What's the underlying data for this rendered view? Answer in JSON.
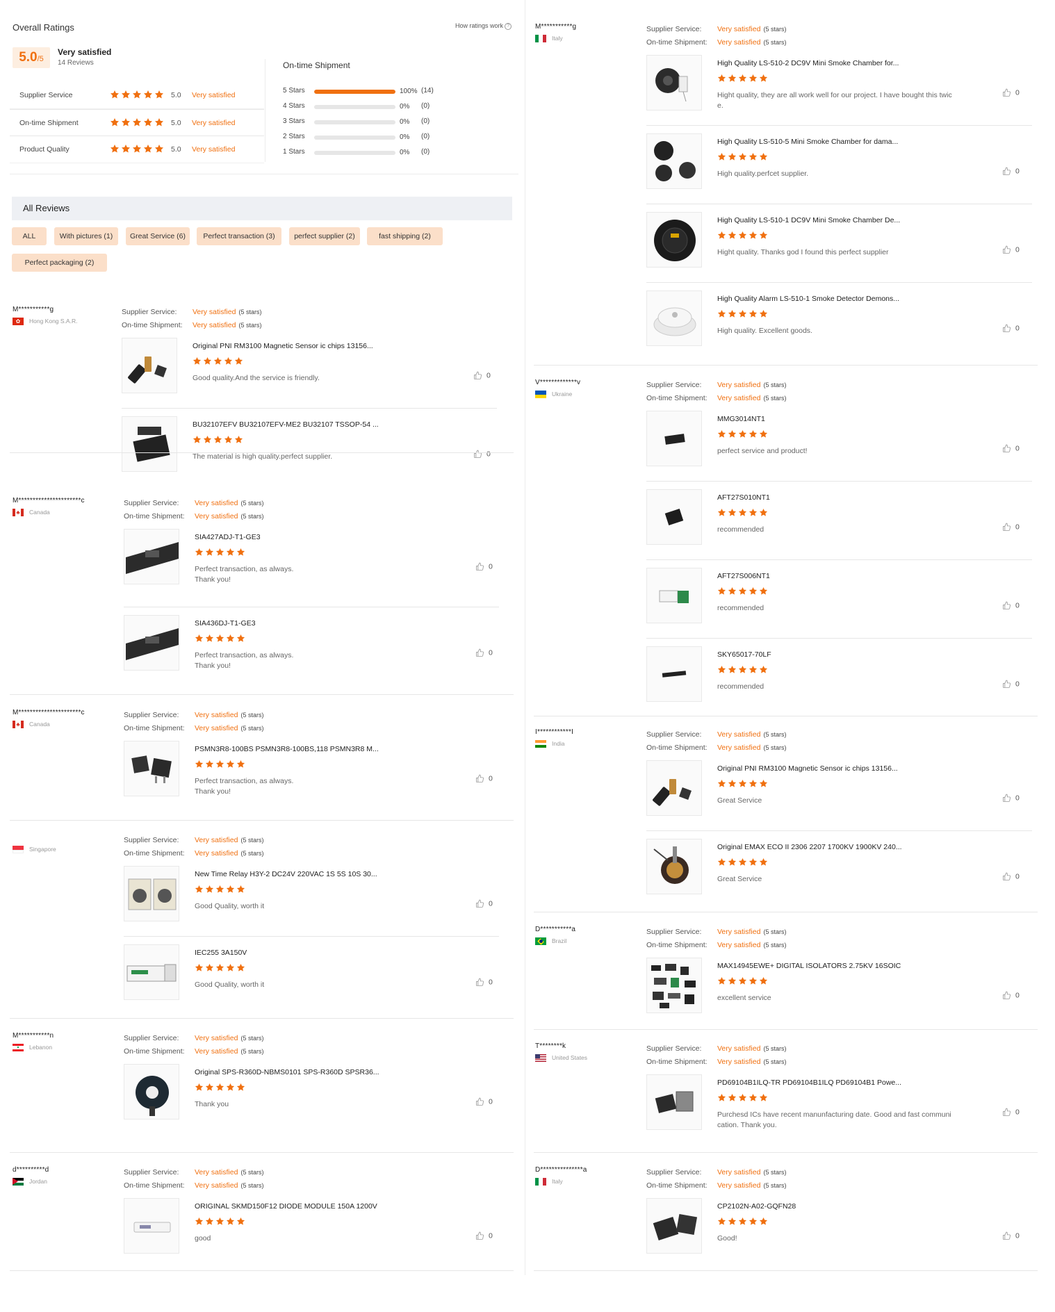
{
  "overall": {
    "header": "Overall Ratings",
    "how_link": "How ratings work",
    "score": "5.0",
    "score_max": "/5",
    "summary": "Very satisfied",
    "review_count": "14 Reviews",
    "rows": [
      {
        "label": "Supplier Service",
        "score": "5.0",
        "text": "Very satisfied",
        "stars": 5
      },
      {
        "label": "On-time Shipment",
        "score": "5.0",
        "text": "Very satisfied",
        "stars": 5
      },
      {
        "label": "Product Quality",
        "score": "5.0",
        "text": "Very satisfied",
        "stars": 5
      }
    ],
    "distribution_title": "On-time Shipment",
    "distribution": [
      {
        "label": "5 Stars",
        "percent": "100%",
        "count": "(14)",
        "fraction": 1.0
      },
      {
        "label": "4 Stars",
        "percent": "0%",
        "count": "(0)",
        "fraction": 0
      },
      {
        "label": "3 Stars",
        "percent": "0%",
        "count": "(0)",
        "fraction": 0
      },
      {
        "label": "2 Stars",
        "percent": "0%",
        "count": "(0)",
        "fraction": 0
      },
      {
        "label": "1 Stars",
        "percent": "0%",
        "count": "(0)",
        "fraction": 0
      }
    ]
  },
  "all_reviews": {
    "title": "All Reviews",
    "filters": [
      "ALL",
      "With pictures (1)",
      "Great Service (6)",
      "Perfect transaction (3)",
      "perfect supplier (2)",
      "fast shipping (2)",
      "Perfect packaging (2)"
    ]
  },
  "labels": {
    "supplier_service": "Supplier Service:",
    "ontime_shipment": "On-time Shipment:",
    "very_satisfied": "Very satisfied",
    "five_stars": "(5 stars)"
  },
  "reviews_left": [
    {
      "user": "M***********g",
      "country": "Hong Kong S.A.R.",
      "flag": "hk",
      "products": [
        {
          "title": "Original PNI RM3100 Magnetic Sensor ic chips 13156...",
          "comment": "Good quality.And the service is friendly.",
          "likes": "0",
          "img": "ic-small"
        },
        {
          "title": "BU32107EFV BU32107EFV-ME2 BU32107 TSSOP-54 ...",
          "comment": "The material is high quality.perfect supplier.",
          "likes": "0",
          "img": "ic-flat"
        }
      ]
    },
    {
      "user": "M**********************c",
      "country": "Canada",
      "flag": "ca",
      "products": [
        {
          "title": "SIA427ADJ-T1-GE3",
          "comment": "Perfect transaction, as always.\nThank you!",
          "likes": "0",
          "img": "tape"
        },
        {
          "title": "SIA436DJ-T1-GE3",
          "comment": "Perfect transaction, as always.\nThank you!",
          "likes": "0",
          "img": "tape"
        }
      ]
    },
    {
      "user": "M**********************c",
      "country": "Canada",
      "flag": "ca",
      "products": [
        {
          "title": "PSMN3R8-100BS PSMN3R8-100BS,118 PSMN3R8 M...",
          "comment": "Perfect transaction, as always.\nThank you!",
          "likes": "0",
          "img": "mosfet"
        }
      ]
    },
    {
      "user": "",
      "country": "Singapore",
      "flag": "sg",
      "products": [
        {
          "title": "New Time Relay H3Y-2 DC24V 220VAC 1S 5S 10S 30...",
          "comment": "Good Quality, worth it",
          "likes": "0",
          "img": "relay"
        },
        {
          "title": "IEC255 3A150V",
          "comment": "Good Quality, worth it",
          "likes": "0",
          "img": "box"
        }
      ]
    },
    {
      "user": "M***********n",
      "country": "Lebanon",
      "flag": "lb",
      "products": [
        {
          "title": "Original SPS-R360D-NBMS0101 SPS-R360D SPSR36...",
          "comment": "Thank you",
          "likes": "0",
          "img": "sensor"
        }
      ]
    },
    {
      "user": "d**********d",
      "country": "Jordan",
      "flag": "jo",
      "products": [
        {
          "title": "ORIGINAL SKMD150F12 DIODE MODULE 150A 1200V",
          "comment": "good",
          "likes": "0",
          "img": "module"
        }
      ]
    }
  ],
  "reviews_right": [
    {
      "user": "M***********g",
      "country": "Italy",
      "flag": "it",
      "products": [
        {
          "title": "High Quality LS-510-2 DC9V Mini Smoke Chamber for...",
          "comment": "Hight quality, they are all work well for our project. I have bought this twic\ne.",
          "likes": "0",
          "img": "chamber"
        },
        {
          "title": "High Quality LS-510-5 Mini Smoke Chamber for dama...",
          "comment": "High quality.perfcet supplier.",
          "likes": "0",
          "img": "chamber2"
        },
        {
          "title": "High Quality LS-510-1 DC9V Mini Smoke Chamber De...",
          "comment": "Hight quality. Thanks god I found this perfect supplier",
          "likes": "0",
          "img": "round"
        },
        {
          "title": "High Quality Alarm LS-510-1 Smoke Detector Demons...",
          "comment": "High quality. Excellent goods.",
          "likes": "0",
          "img": "detector"
        }
      ]
    },
    {
      "user": "V*************v",
      "country": "Ukraine",
      "flag": "ua",
      "products": [
        {
          "title": "MMG3014NT1",
          "comment": "perfect service and product!",
          "likes": "0",
          "img": "chip-sm"
        },
        {
          "title": "AFT27S010NT1",
          "comment": "recommended",
          "likes": "0",
          "img": "chip-sq"
        },
        {
          "title": "AFT27S006NT1",
          "comment": "recommended",
          "likes": "0",
          "img": "chip-green"
        },
        {
          "title": "SKY65017-70LF",
          "comment": "recommended",
          "likes": "0",
          "img": "chip-line"
        }
      ]
    },
    {
      "user": "I************I",
      "country": "India",
      "flag": "in",
      "products": [
        {
          "title": "Original PNI RM3100 Magnetic Sensor ic chips 13156...",
          "comment": "Great Service",
          "likes": "0",
          "img": "ic-small"
        },
        {
          "title": "Original EMAX ECO II 2306 2207 1700KV 1900KV 240...",
          "comment": "Great Service",
          "likes": "0",
          "img": "motor"
        }
      ]
    },
    {
      "user": "D***********a",
      "country": "Brazil",
      "flag": "br",
      "products": [
        {
          "title": "MAX14945EWE+ DIGITAL ISOLATORS 2.75KV 16SOIC",
          "comment": "excellent service",
          "likes": "0",
          "img": "many"
        }
      ]
    },
    {
      "user": "T********k",
      "country": "United States",
      "flag": "us",
      "products": [
        {
          "title": "PD69104B1ILQ-TR PD69104B1ILQ PD69104B1 Powe...",
          "comment": "Purchesd ICs have recent manunfacturing  date. Good and fast communi\ncation. Thank you.",
          "likes": "0",
          "img": "qfn"
        }
      ]
    },
    {
      "user": "D***************a",
      "country": "Italy",
      "flag": "it",
      "products": [
        {
          "title": "CP2102N-A02-GQFN28",
          "comment": "Good!",
          "likes": "0",
          "img": "qfn2"
        }
      ]
    }
  ],
  "colors": {
    "accent": "#f07010",
    "chip_bg": "#fbdfc9",
    "bar_bg": "#eef0f4"
  }
}
